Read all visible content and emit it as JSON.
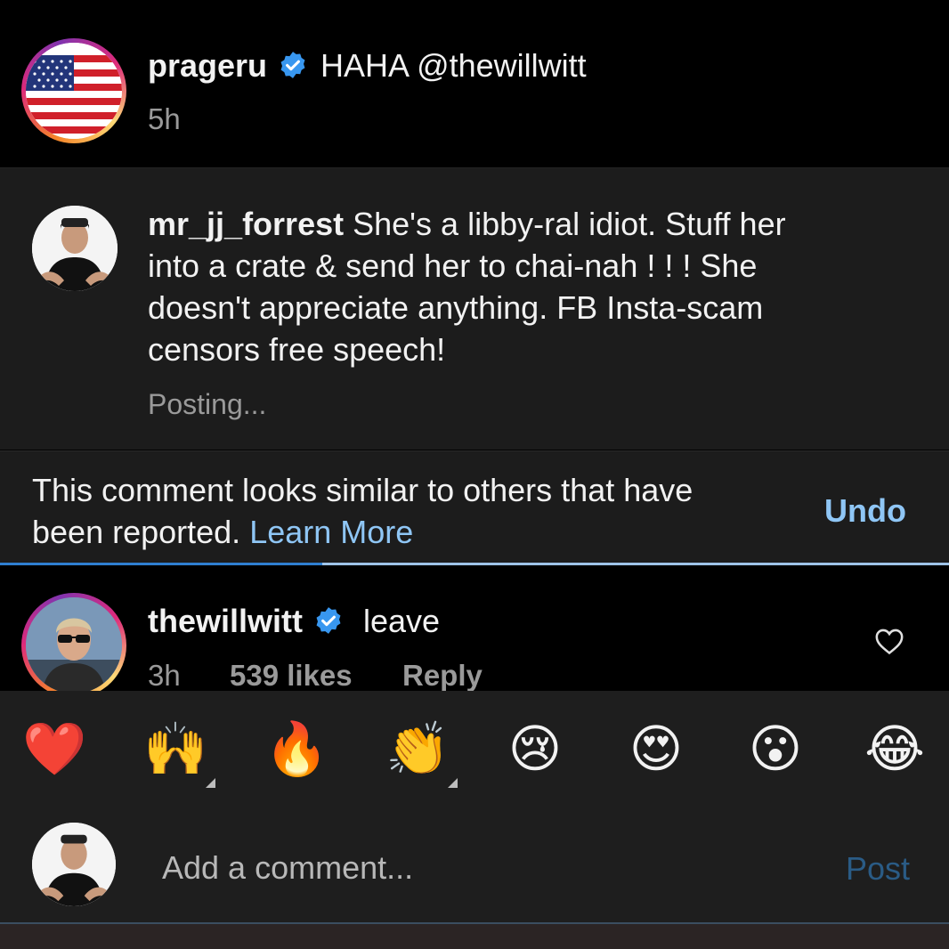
{
  "caption": {
    "username": "prageru",
    "text": "HAHA @thewillwitt",
    "time": "5h"
  },
  "pending_comment": {
    "username": "mr_jj_forrest",
    "lines": [
      "She's a libby-ral idiot. Stuff her",
      "into a crate & send her to chai-nah ! ! ! She",
      "doesn't appreciate anything. FB Insta-scam",
      "censors free speech!"
    ],
    "status": "Posting..."
  },
  "notice": {
    "line1": "This comment looks similar to others that have",
    "line2": "been reported.",
    "learn_more": "Learn More",
    "undo": "Undo",
    "progress": 0.34
  },
  "comment": {
    "username": "thewillwitt",
    "text": "leave",
    "time": "3h",
    "likes": "539 likes",
    "reply": "Reply"
  },
  "reactions": [
    {
      "icon": "red-heart-icon",
      "glyph": "❤️",
      "has_variants": false
    },
    {
      "icon": "raising-hands-icon",
      "glyph": "🙌",
      "has_variants": true
    },
    {
      "icon": "fire-icon",
      "glyph": "🔥",
      "has_variants": false
    },
    {
      "icon": "clapping-hands-icon",
      "glyph": "👏",
      "has_variants": true
    },
    {
      "icon": "crying-face-icon",
      "glyph": "😢",
      "has_variants": false
    },
    {
      "icon": "heart-eyes-icon",
      "glyph": "😍",
      "has_variants": false
    },
    {
      "icon": "surprised-face-icon",
      "glyph": "😮",
      "has_variants": false
    },
    {
      "icon": "tears-of-joy-icon",
      "glyph": "😂",
      "has_variants": false
    }
  ],
  "composer": {
    "placeholder": "Add a comment...",
    "post": "Post"
  },
  "colors": {
    "verified": "#3897f0",
    "link": "#8fc6f5",
    "post_disabled": "#2a5b85"
  }
}
